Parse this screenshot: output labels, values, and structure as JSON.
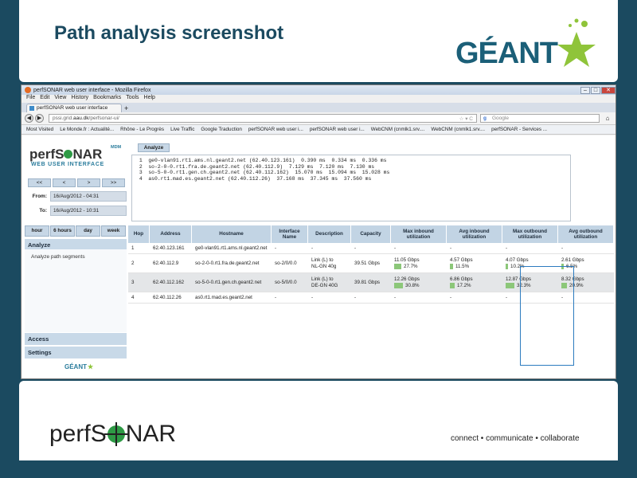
{
  "slide": {
    "title": "Path analysis screenshot",
    "tagline": "connect • communicate • collaborate",
    "geant_logo": "GÉANT",
    "perfsonar_logo_left": "perfS",
    "perfsonar_logo_right": "NAR"
  },
  "browser": {
    "window_title": "perfSONAR web user interface - Mozilla Firefox",
    "menu": [
      "File",
      "Edit",
      "View",
      "History",
      "Bookmarks",
      "Tools",
      "Help"
    ],
    "tab_label": "perfSONAR web user interface",
    "url_prefix": "pssi.grid.",
    "url_domain": "aau.dk",
    "url_path": "/perfsonar-ui/",
    "search_placeholder": "Google",
    "bookmarks": [
      "Most Visited",
      "Le Monde.fr : Actualité...",
      "Rhône - Le Progrès",
      "Live Traffic",
      "Google Traduction",
      "perfSONAR web user i...",
      "perfSONAR web user i...",
      "WebCNM (cnmlk1.srv....",
      "WebCNM (cnmlk1.srv....",
      "perfSONAR - Services ..."
    ]
  },
  "app": {
    "logo_left": "perfS",
    "logo_right": "NAR",
    "logo_badge": "MDM",
    "logo_subtitle": "WEB USER INTERFACE",
    "nav_buttons": [
      "<<",
      "<",
      ">",
      ">>"
    ],
    "from_label": "From:",
    "from_value": "16/Aug/2012 - 04:31",
    "to_label": "To:",
    "to_value": "16/Aug/2012 - 10:31",
    "range_buttons": [
      "hour",
      "6 hours",
      "day",
      "week"
    ],
    "section_analyze": "Analyze",
    "analyze_item": "Analyze path segments",
    "section_access": "Access",
    "section_settings": "Settings",
    "footer_logo": "GÉANT",
    "analyze_tab": "Analyze",
    "traceroute": " 1  ge0-vlan91.rt1.ams.nl.geant2.net (62.40.123.161)  0.390 ms  0.334 ms  0.336 ms\n 2  so-2-0-0.rt1.fra.de.geant2.net (62.40.112.9)  7.129 ms  7.120 ms  7.130 ms\n 3  so-5-0-0.rt1.gen.ch.geant2.net (62.40.112.162)  15.070 ms  15.094 ms  15.028 ms\n 4  as0.rt1.mad.es.geant2.net (62.40.112.26)  37.168 ms  37.345 ms  37.560 ms"
  },
  "results": {
    "headers": [
      "Hop",
      "Address",
      "Hostname",
      "Interface Name",
      "Description",
      "Capacity",
      "Max inbound utilization",
      "Avg inbound utilization",
      "Max outbound utilization",
      "Avg outbound utilization"
    ],
    "rows": [
      {
        "hop": "1",
        "address": "62.40.123.161",
        "hostname": "ge0-vlan91.rt1.ams.nl.geant2.net",
        "interface": "-",
        "description": "-",
        "capacity": "-",
        "max_in": "-",
        "avg_in": "-",
        "max_out": "-",
        "avg_out": "-"
      },
      {
        "hop": "2",
        "address": "62.40.112.9",
        "hostname": "so-2-0-0.rt1.fra.de.geant2.net",
        "interface": "so-2/0/0.0",
        "description": "Link (L) to\nNL-GN 40g",
        "capacity": "39.51 Gbps",
        "max_in": "11.05 Gbps",
        "max_in_pct": "27.7%",
        "max_in_frac": 0.277,
        "avg_in": "4.57 Gbps",
        "avg_in_pct": "11.5%",
        "avg_in_frac": 0.115,
        "max_out": "4.07 Gbps",
        "max_out_pct": "10.2%",
        "max_out_frac": 0.102,
        "avg_out": "2.61 Gbps",
        "avg_out_pct": "6.5%",
        "avg_out_frac": 0.065
      },
      {
        "hop": "3",
        "address": "62.40.112.162",
        "hostname": "so-5-0-0.rt1.gen.ch.geant2.net",
        "interface": "so-5/0/0.0",
        "description": "Link (L) to\nDE-GN 40G",
        "capacity": "39.81 Gbps",
        "max_in": "12.26 Gbps",
        "max_in_pct": "30.8%",
        "max_in_frac": 0.308,
        "avg_in": "6.86 Gbps",
        "avg_in_pct": "17.2%",
        "avg_in_frac": 0.172,
        "max_out": "12.87 Gbps",
        "max_out_pct": "32.3%",
        "max_out_frac": 0.323,
        "avg_out": "8.32 Gbps",
        "avg_out_pct": "20.9%",
        "avg_out_frac": 0.209
      },
      {
        "hop": "4",
        "address": "62.40.112.26",
        "hostname": "as0.rt1.mad.es.geant2.net",
        "interface": "-",
        "description": "-",
        "capacity": "-",
        "max_in": "-",
        "avg_in": "-",
        "max_out": "-",
        "avg_out": "-"
      }
    ]
  },
  "colors": {
    "background": "#1b4a60",
    "accent_green": "#2e9a45",
    "highlight_border": "#2c7bbf",
    "bar_green": "#8cc779"
  }
}
